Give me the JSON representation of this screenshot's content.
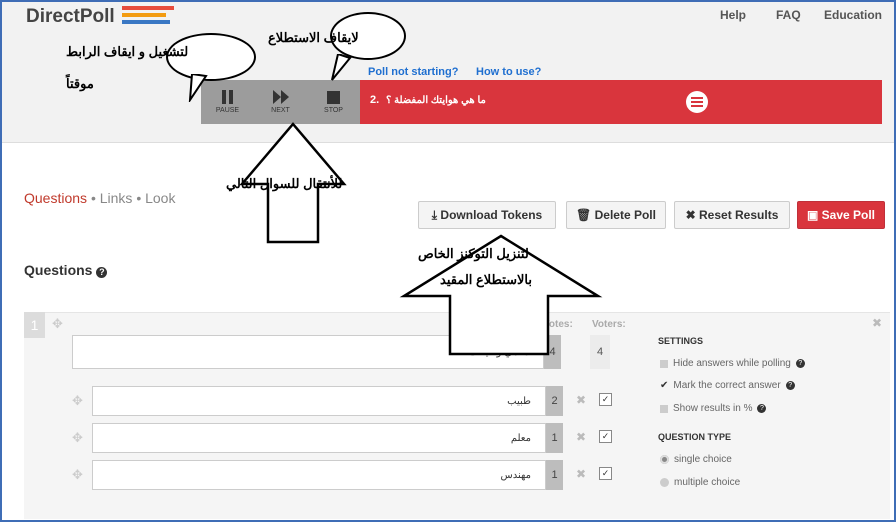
{
  "app": {
    "logo_text": "DirectPoll",
    "logo_colors": [
      "#e74c3c",
      "#f39c12",
      "#3a78c4"
    ]
  },
  "nav": {
    "help": "Help",
    "faq": "FAQ",
    "education": "Education"
  },
  "help_links": {
    "poll_not_starting": "Poll not starting?",
    "how_to_use": "How to use?"
  },
  "player": {
    "pause_label": "PAUSE",
    "next_label": "NEXT",
    "stop_label": "STOP"
  },
  "current_question": {
    "number": "2.",
    "text": "ما هي هوايتك المفضلة ؟"
  },
  "annotations": {
    "stop_poll": "لايقاف الاستطلاع",
    "start_pause_link": "لتشغيل و ايقاف الرابط",
    "temporarily": "موقتاً",
    "next_question": "للأنتقال للسوال التالي",
    "download_tokens_line1": "لتنزيل التوكنز الخاص",
    "download_tokens_line2": "بالاستطلاع المقيد"
  },
  "tabs": {
    "questions": "Questions",
    "sep1": "•",
    "links": "Links",
    "sep2": "•",
    "look": "Look"
  },
  "buttons": {
    "download_tokens": "Download Tokens",
    "delete_poll": "Delete Poll",
    "reset_results": "Reset Results",
    "save_poll": "Save Poll"
  },
  "questions_section": {
    "title": "Questions",
    "help_icon": "?"
  },
  "question": {
    "index": "1",
    "votes_label": "Votes:",
    "voters_label": "Voters:",
    "text": "ما هي وظيفتك ؟",
    "votes": "4",
    "voters": "4",
    "answers": [
      {
        "text": "طبيب",
        "votes": "2"
      },
      {
        "text": "معلم",
        "votes": "1"
      },
      {
        "text": "مهندس",
        "votes": "1"
      }
    ]
  },
  "settings": {
    "title": "SETTINGS",
    "hide_answers": "Hide answers while polling",
    "mark_correct": "Mark the correct answer",
    "show_percent": "Show results in %",
    "qtype_title": "QUESTION TYPE",
    "single_choice": "single choice",
    "multiple_choice": "multiple choice"
  }
}
